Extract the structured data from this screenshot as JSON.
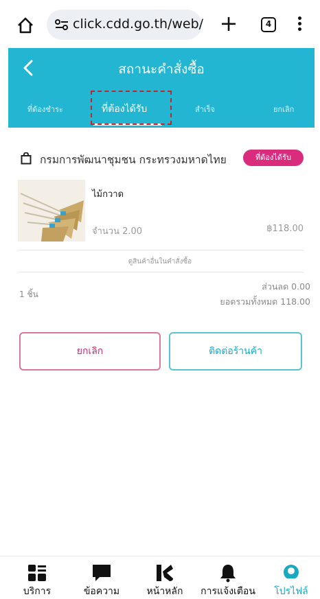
{
  "browser": {
    "url": "click.cdd.go.th/web/",
    "tab_count": "4"
  },
  "header": {
    "title": "สถานะคำสั่งซื้อ",
    "tabs": [
      {
        "label": "ที่ต้องชำระ",
        "active": false
      },
      {
        "label": "ที่ต้องได้รับ",
        "active": true
      },
      {
        "label": "สำเร็จ",
        "active": false
      },
      {
        "label": "ยกเลิก",
        "active": false
      }
    ]
  },
  "order": {
    "shop_name": "กรมการพัฒนาชุมชน กระทรวงมหาดไทย",
    "status": "ที่ต้องได้รับ",
    "product": {
      "name": "ไม้กวาด",
      "quantity": "จำนวน 2.00",
      "price": "฿118.00"
    },
    "view_more": "ดูสินค้าอื่นในคำสั่งซื้อ",
    "item_count": "1 ชิ้น",
    "discount": "ส่วนลด 0.00",
    "grand_total": "ยอดรวมทั้งหมด 118.00"
  },
  "actions": {
    "cancel": "ยกเลิก",
    "contact": "ติดต่อร้านค้า"
  },
  "bottom_nav": [
    {
      "label": "บริการ",
      "icon": "grid-icon"
    },
    {
      "label": "ข้อความ",
      "icon": "chat-icon"
    },
    {
      "label": "หน้าหลัก",
      "icon": "home-logo-icon"
    },
    {
      "label": "การแจ้งเตือน",
      "icon": "bell-icon"
    },
    {
      "label": "โปรไฟล์",
      "icon": "profile-icon"
    }
  ],
  "colors": {
    "header": "#22b6d2",
    "badge": "#d92c7d",
    "cancel": "#c72b72",
    "contact": "#1aa8c3",
    "active_nav": "#1aa8c3",
    "highlight_box": "#c0272d"
  }
}
